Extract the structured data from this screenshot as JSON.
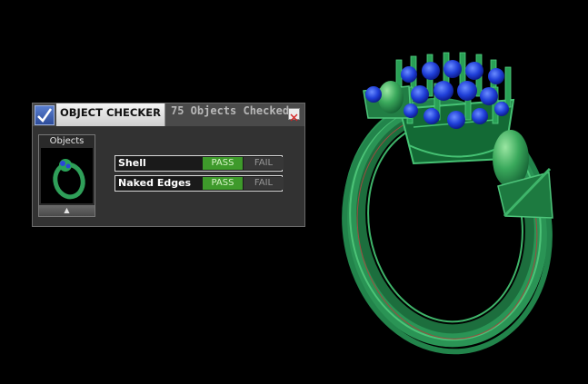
{
  "viewport": {
    "background": "#000000",
    "model_color": "#2d9a5a",
    "gem_color": "#1b3fd6"
  },
  "checker": {
    "title": "OBJECT CHECKER",
    "count_text": "75 Objects Checked",
    "objects_label": "Objects",
    "checks": [
      {
        "label": "Shell",
        "pass": "PASS",
        "fail": "FAIL",
        "result": "PASS"
      },
      {
        "label": "Naked Edges",
        "pass": "PASS",
        "fail": "FAIL",
        "result": "PASS"
      }
    ],
    "pass_color": "#3e9a2b",
    "fail_color": "#373737"
  }
}
